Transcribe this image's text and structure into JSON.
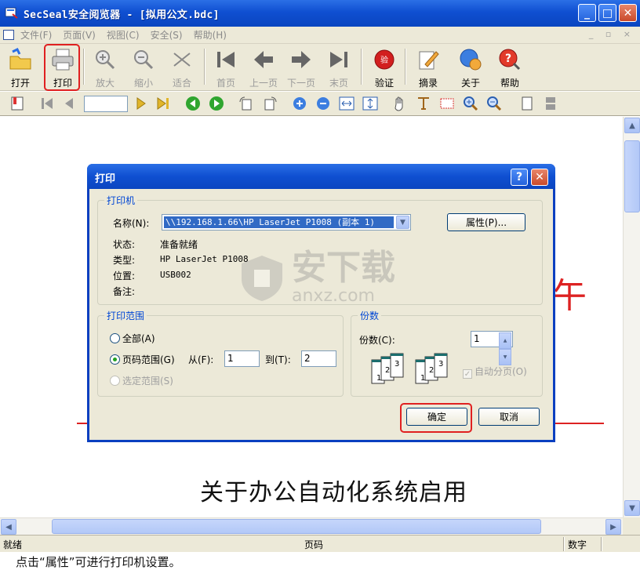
{
  "window": {
    "title": "SecSeal安全阅览器 - [拟用公文.bdc]",
    "min_glyph": "_",
    "max_glyph": "□",
    "close_glyph": "✕"
  },
  "menu": {
    "items": [
      "文件(F)",
      "页面(V)",
      "视图(C)",
      "安全(S)",
      "帮助(H)"
    ],
    "mdi_controls": "_ ▫ ×"
  },
  "toolbar": {
    "open": "打开",
    "print": "打印",
    "zoom_in": "放大",
    "zoom_out": "缩小",
    "fit": "适合",
    "first_page": "首页",
    "prev_page": "上一页",
    "next_page": "下一页",
    "last_page": "末页",
    "verify": "验证",
    "excerpt": "摘录",
    "about": "关于",
    "help": "帮助"
  },
  "document": {
    "title": "关于办公自动化系统启用",
    "red_glyph": "午"
  },
  "print_dialog": {
    "title": "打印",
    "help_glyph": "?",
    "close_glyph": "✕",
    "printer_group": "打印机",
    "name_label": "名称(N):",
    "printer_name": "\\\\192.168.1.66\\HP LaserJet P1008 (副本 1)",
    "properties_button": "属性(P)...",
    "status_label": "状态:",
    "status_value": "准备就绪",
    "type_label": "类型:",
    "type_value": "HP LaserJet P1008",
    "where_label": "位置:",
    "where_value": "USB002",
    "comment_label": "备注:",
    "range_group": "打印范围",
    "range_all": "全部(A)",
    "range_pages": "页码范围(G)",
    "from_label": "从(F):",
    "from_value": "1",
    "to_label": "到(T):",
    "to_value": "2",
    "range_selection": "选定范围(S)",
    "copies_group": "份数",
    "copies_label": "份数(C):",
    "copies_value": "1",
    "collate_label": "自动分页(O)",
    "collate_pages": [
      "1",
      "2",
      "3"
    ],
    "ok_button": "确定",
    "cancel_button": "取消"
  },
  "statusbar": {
    "ready": "就绪",
    "page": "页码",
    "num": "数字"
  },
  "caption": "点击“属性”可进行打印机设置。",
  "watermark": {
    "brand": "安下载",
    "url": "anxz.com"
  },
  "colors": {
    "title_blue": "#0a45c0",
    "highlight_red": "#e02020",
    "group_title_blue": "#0046d5"
  }
}
